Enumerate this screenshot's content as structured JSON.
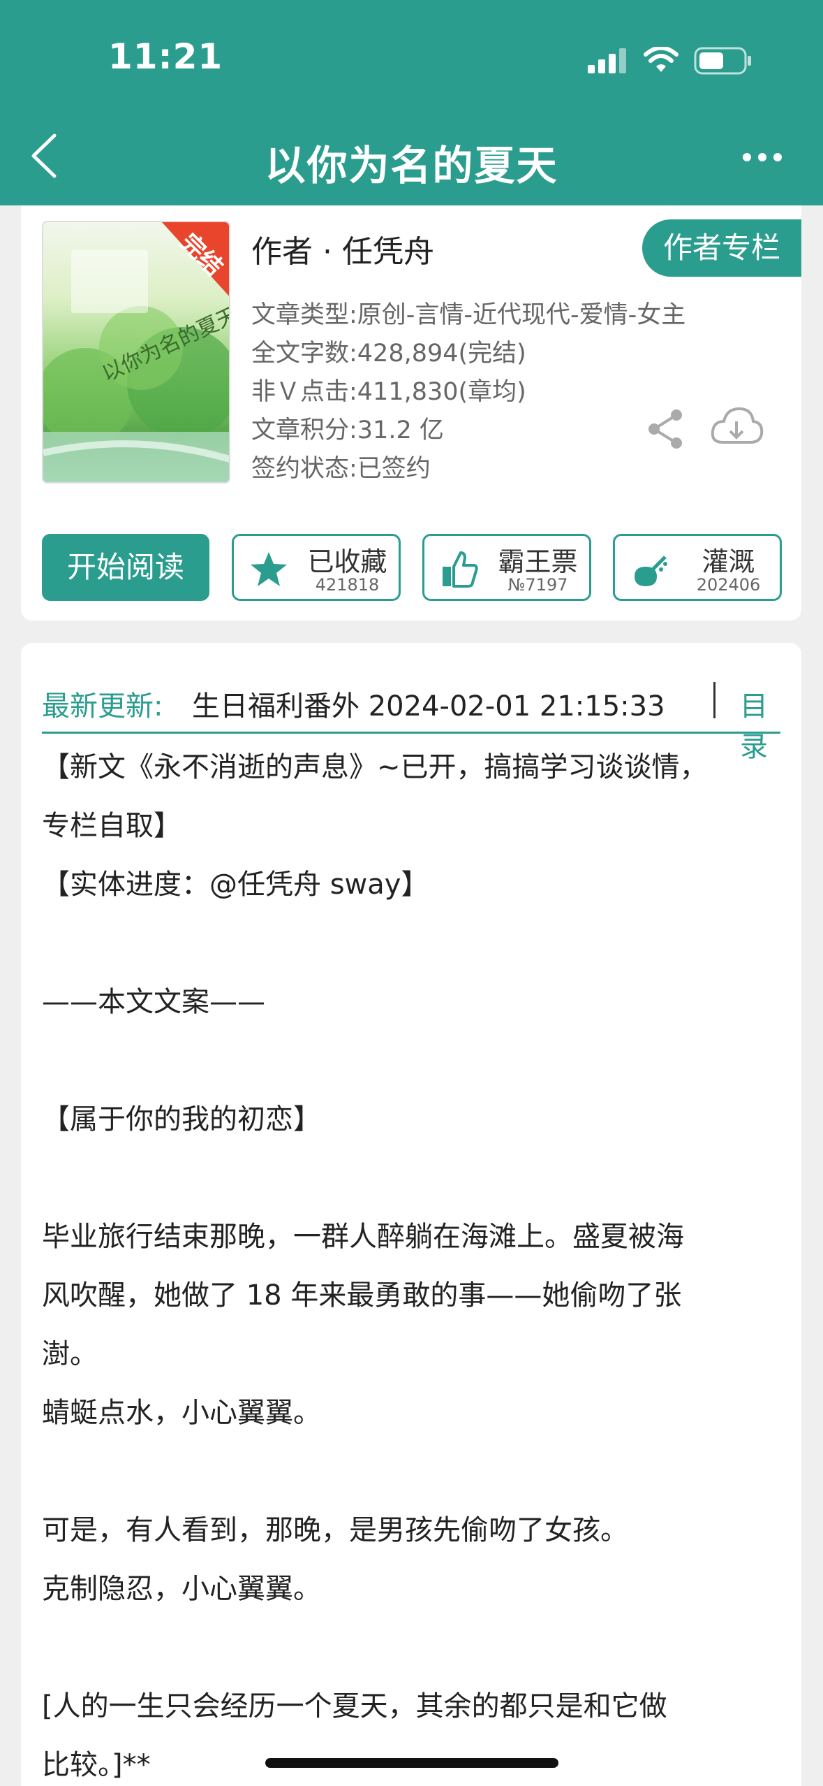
{
  "status_bar": {
    "time": "11:21"
  },
  "nav": {
    "title": "以你为名的夏天"
  },
  "book": {
    "cover_badge": "完结",
    "cover_title": "以你为名的夏天",
    "author": "作者 · 任凭舟",
    "author_column_label": "作者专栏",
    "meta": [
      "文章类型:原创-言情-近代现代-爱情-女主",
      "全文字数:428,894(完结)",
      "非Ｖ点击:411,830(章均)",
      "文章积分:31.2 亿",
      "签约状态:已签约"
    ]
  },
  "actions": {
    "read": "开始阅读",
    "collect": {
      "label": "已收藏",
      "count": "421818"
    },
    "vote": {
      "label": "霸王票",
      "count": "№7197"
    },
    "water": {
      "label": "灌溉",
      "count": "202406"
    }
  },
  "update": {
    "label": "最新更新:",
    "text": "生日福利番外 2024-02-01 21:15:33",
    "toc": "目录"
  },
  "intro": [
    "【新文《永不消逝的声息》~已开，搞搞学习谈谈情，",
    "专栏自取】",
    "【实体进度：@任凭舟 sway】",
    "",
    "——本文文案——",
    "",
    "【属于你的我的初恋】",
    "",
    "毕业旅行结束那晚，一群人醉躺在海滩上。盛夏被海",
    "风吹醒，她做了 18 年来最勇敢的事——她偷吻了张",
    "澍。",
    "蜻蜓点水，小心翼翼。",
    "",
    "可是，有人看到，那晚，是男孩先偷吻了女孩。",
    "克制隐忍，小心翼翼。",
    "",
    "[人的一生只会经历一个夏天，其余的都只是和它做",
    "比较。]**"
  ],
  "colors": {
    "accent": "#2a9d8f",
    "cover_badge": "#e8452c"
  }
}
